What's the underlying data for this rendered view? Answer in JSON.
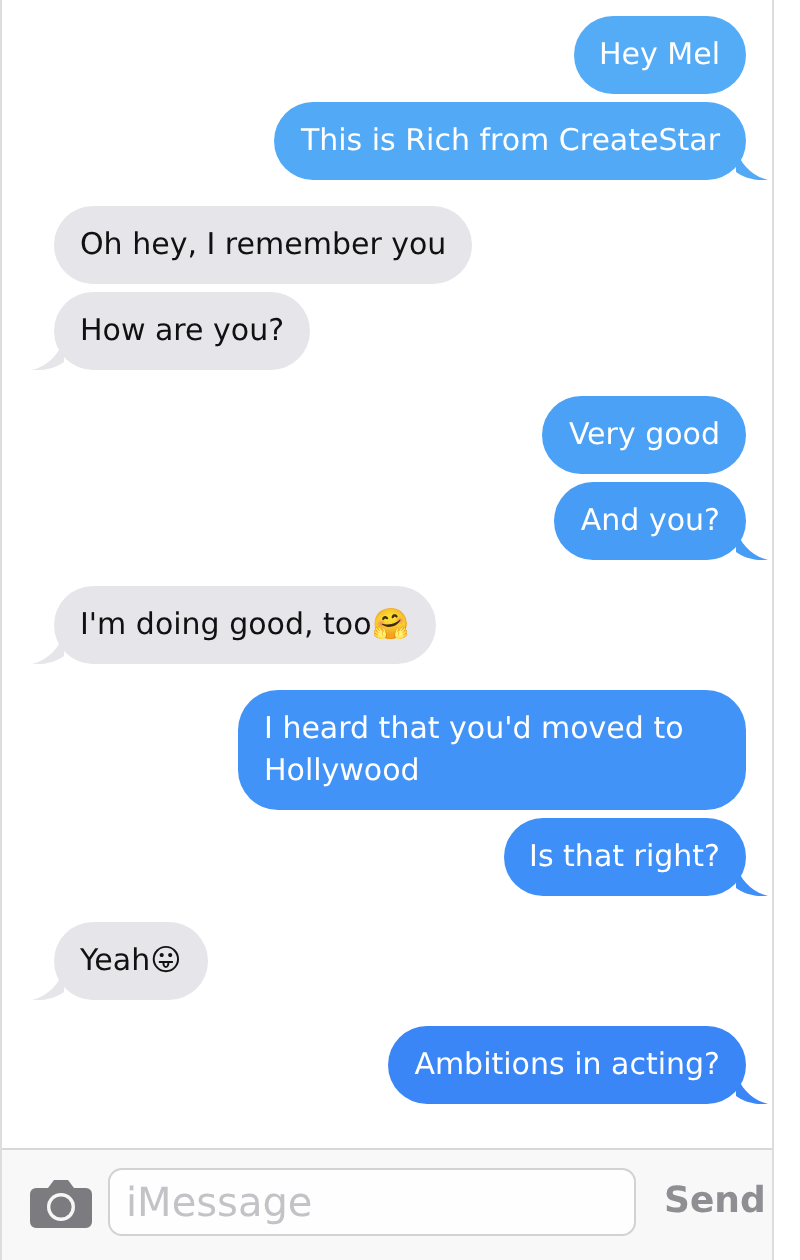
{
  "messages": [
    {
      "kind": "sent",
      "text": "Hey Mel",
      "color": "#55acf6",
      "tail": false
    },
    {
      "kind": "sent",
      "text": "This is Rich from CreateStar",
      "color": "#52a9f6",
      "tail": true
    },
    {
      "kind": "received",
      "text": "Oh hey, I remember you",
      "tail": false
    },
    {
      "kind": "received",
      "text": "How are you?",
      "tail": true
    },
    {
      "kind": "sent",
      "text": "Very good",
      "color": "#4ba1f6",
      "tail": false
    },
    {
      "kind": "sent",
      "text": "And you?",
      "color": "#479df6",
      "tail": true
    },
    {
      "kind": "received",
      "text": "I'm doing good, too🤗",
      "tail": true
    },
    {
      "kind": "sent",
      "text": "I heard that you'd moved to Hollywood",
      "color": "#4293f8",
      "tail": false
    },
    {
      "kind": "sent",
      "text": "Is that right?",
      "color": "#3f8ff8",
      "tail": true
    },
    {
      "kind": "received",
      "text": "Yeah😛",
      "tail": true
    },
    {
      "kind": "sent",
      "text": "Ambitions in acting?",
      "color": "#3a86f7",
      "tail": true
    }
  ],
  "composer": {
    "placeholder": "iMessage",
    "send": "Send"
  }
}
